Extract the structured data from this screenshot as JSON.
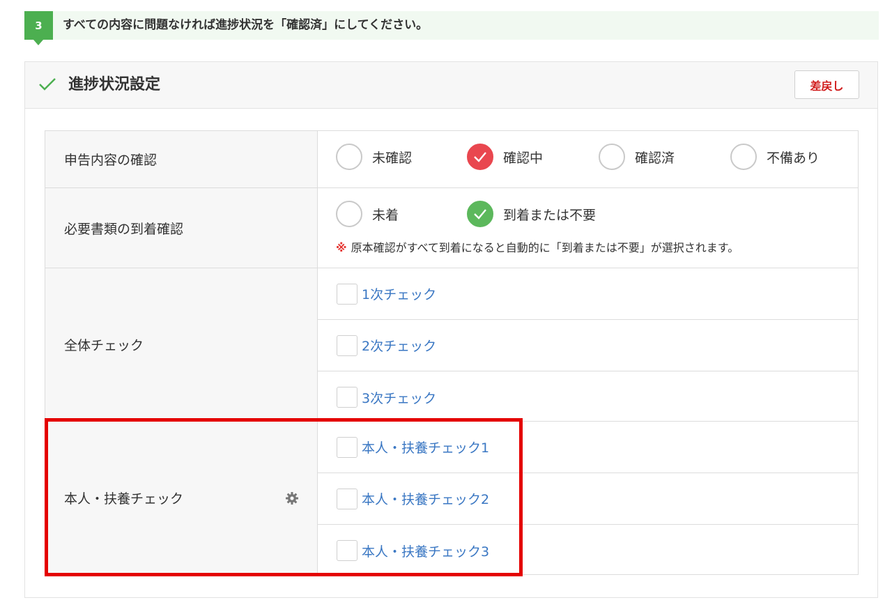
{
  "step": {
    "number": "3",
    "instruction": "すべての内容に問題なければ進捗状況を「確認済」にしてください。"
  },
  "panel": {
    "title": "進捗状況設定",
    "return_button": "差戻し"
  },
  "rows": {
    "declaration": {
      "label": "申告内容の確認",
      "options": [
        "未確認",
        "確認中",
        "確認済",
        "不備あり"
      ],
      "selected": "確認中"
    },
    "documents": {
      "label": "必要書類の到着確認",
      "options": [
        "未着",
        "到着または不要"
      ],
      "selected": "到着または不要",
      "note_mark": "※",
      "note": "原本確認がすべて到着になると自動的に「到着または不要」が選択されます。"
    },
    "overall": {
      "label": "全体チェック",
      "items": [
        "1次チェック",
        "2次チェック",
        "3次チェック"
      ]
    },
    "dependents": {
      "label": "本人・扶養チェック",
      "items": [
        "本人・扶養チェック1",
        "本人・扶養チェック2",
        "本人・扶養チェック3"
      ]
    }
  },
  "colors": {
    "accent_green": "#4caf50",
    "selected_red": "#e9474f",
    "selected_green": "#5cb85c",
    "link_blue": "#3a77c3",
    "highlight_red": "#e40000"
  }
}
